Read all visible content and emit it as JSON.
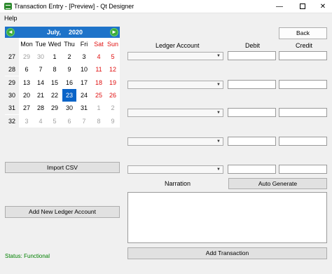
{
  "window": {
    "title": "Transaction Entry - [Preview] - Qt Designer",
    "min_glyph": "—",
    "close_glyph": "✕"
  },
  "menu": {
    "help": "Help"
  },
  "calendar": {
    "month": "July,",
    "year": "2020",
    "prev_glyph": "◄",
    "next_glyph": "►",
    "weekdays": [
      "Mon",
      "Tue",
      "Wed",
      "Thu",
      "Fri",
      "Sat",
      "Sun"
    ],
    "weeks": [
      {
        "week": "27",
        "days": [
          "29",
          "30",
          "1",
          "2",
          "3",
          "4",
          "5"
        ]
      },
      {
        "week": "28",
        "days": [
          "6",
          "7",
          "8",
          "9",
          "10",
          "11",
          "12"
        ]
      },
      {
        "week": "29",
        "days": [
          "13",
          "14",
          "15",
          "16",
          "17",
          "18",
          "19"
        ]
      },
      {
        "week": "30",
        "days": [
          "20",
          "21",
          "22",
          "23",
          "24",
          "25",
          "26"
        ]
      },
      {
        "week": "31",
        "days": [
          "27",
          "28",
          "29",
          "30",
          "31",
          "1",
          "2"
        ]
      },
      {
        "week": "32",
        "days": [
          "3",
          "4",
          "5",
          "6",
          "7",
          "8",
          "9"
        ]
      }
    ],
    "selected_day": "23",
    "colors": {
      "header": "#1e73c9",
      "selected": "#0a64c8",
      "weekend": "#e01010",
      "other_month": "#a0a0a0"
    }
  },
  "buttons": {
    "back": "Back",
    "import_csv": "Import CSV",
    "add_ledger": "Add New Ledger Account",
    "auto_generate": "Auto Generate",
    "add_transaction": "Add Transaction"
  },
  "columns": {
    "ledger_account": "Ledger Account",
    "debit": "Debit",
    "credit": "Credit"
  },
  "entries": [
    {
      "ledger": "",
      "debit": "",
      "credit": ""
    },
    {
      "ledger": "",
      "debit": "",
      "credit": ""
    },
    {
      "ledger": "",
      "debit": "",
      "credit": ""
    },
    {
      "ledger": "",
      "debit": "",
      "credit": ""
    },
    {
      "ledger": "",
      "debit": "",
      "credit": ""
    }
  ],
  "narration": {
    "label": "Narration",
    "value": ""
  },
  "status": {
    "text": "Status: Functional",
    "color": "#008000"
  }
}
